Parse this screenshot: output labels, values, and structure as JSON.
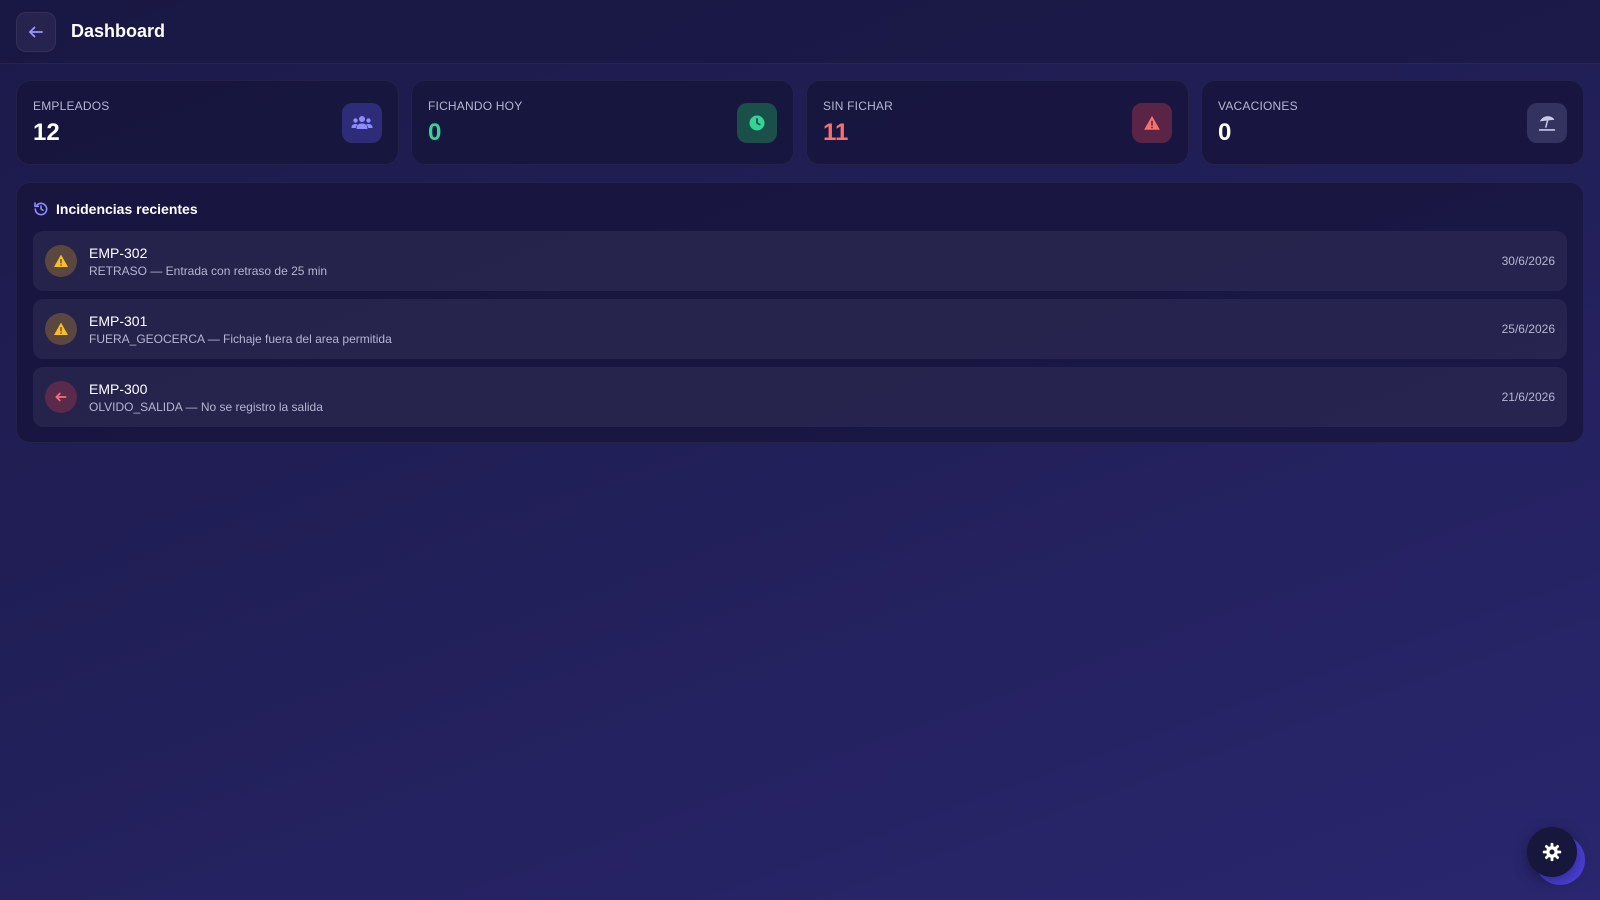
{
  "header": {
    "title": "Dashboard"
  },
  "stats": [
    {
      "label": "EMPLEADOS",
      "value": "12",
      "icon": "users-icon",
      "value_color": "#ffffff"
    },
    {
      "label": "FICHANDO HOY",
      "value": "0",
      "icon": "clock-icon",
      "value_color": "#34d399"
    },
    {
      "label": "SIN FICHAR",
      "value": "11",
      "icon": "warning-icon",
      "value_color": "#f87171"
    },
    {
      "label": "VACACIONES",
      "value": "0",
      "icon": "umbrella-beach-icon",
      "value_color": "#ffffff"
    }
  ],
  "incidents_panel": {
    "title": "Incidencias recientes",
    "icon": "history-icon",
    "items": [
      {
        "employee": "EMP-302",
        "description": "RETRASO — Entrada con retraso de 25 min",
        "date": "30/6/2026",
        "icon": "warning-icon"
      },
      {
        "employee": "EMP-301",
        "description": "FUERA_GEOCERCA — Fichaje fuera del area permitida",
        "date": "25/6/2026",
        "icon": "warning-icon"
      },
      {
        "employee": "EMP-300",
        "description": "OLVIDO_SALIDA — No se registro la salida",
        "date": "21/6/2026",
        "icon": "arrow-left-icon"
      }
    ]
  },
  "settings_button": {
    "icon": "gear-icon"
  },
  "colors": {
    "accent": "#7b78f0",
    "success": "#34d399",
    "danger": "#f87171",
    "warning": "#fbbf24"
  }
}
